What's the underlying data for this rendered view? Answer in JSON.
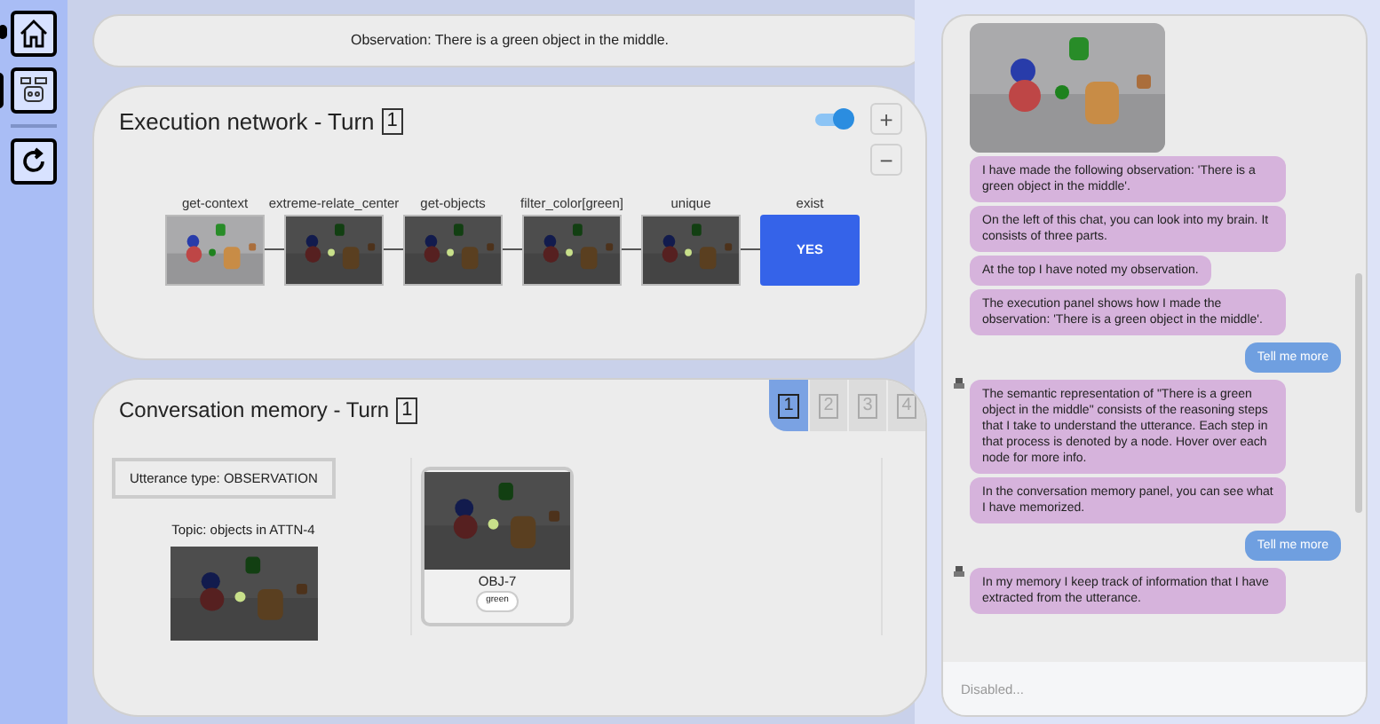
{
  "observation": "Observation: There is a green object in the middle.",
  "execution": {
    "title": "Execution network - Turn",
    "turn": "1",
    "toggle": {
      "on": true
    },
    "zoom_in": "+",
    "zoom_out": "−",
    "nodes": [
      {
        "label": "get-context",
        "kind": "scene"
      },
      {
        "label": "extreme-relate_center",
        "kind": "attention"
      },
      {
        "label": "get-objects",
        "kind": "attention"
      },
      {
        "label": "filter_color[green]",
        "kind": "attention"
      },
      {
        "label": "unique",
        "kind": "attention"
      },
      {
        "label": "exist",
        "kind": "answer",
        "answer": "YES"
      }
    ]
  },
  "memory": {
    "title": "Conversation memory - Turn",
    "turn": "1",
    "tabs": [
      {
        "label": "1",
        "selected": true
      },
      {
        "label": "2",
        "selected": false
      },
      {
        "label": "3",
        "selected": false
      },
      {
        "label": "4",
        "selected": false
      }
    ],
    "utterance_type": "Utterance type: OBSERVATION",
    "topic": "Topic: objects in ATTN-4",
    "objects": [
      {
        "name": "OBJ-7",
        "tags": [
          "green"
        ]
      }
    ]
  },
  "chat": {
    "messages": [
      {
        "kind": "picture"
      },
      {
        "kind": "bot",
        "text": "I have made the following observation: 'There is a green object in the middle'."
      },
      {
        "kind": "bot",
        "text": "On the left of this chat, you can look into my brain. It consists of three parts."
      },
      {
        "kind": "bot",
        "text": "At the top I have noted my observation."
      },
      {
        "kind": "bot",
        "text": "The execution panel shows how I made the observation: 'There is a green object in the middle'."
      },
      {
        "kind": "user",
        "text": "Tell me more"
      },
      {
        "kind": "bot",
        "text": "The semantic representation of \"There is a green object in the middle\" consists of the reasoning steps that I take to understand the utterance. Each step in that process is denoted by a node. Hover over each node for more info."
      },
      {
        "kind": "bot",
        "text": "In the conversation memory panel, you can see what I have memorized."
      },
      {
        "kind": "user",
        "text": "Tell me more"
      },
      {
        "kind": "bot",
        "text": "In my memory I keep track of information that I have extracted from the utterance."
      }
    ],
    "input": {
      "placeholder": "Disabled..."
    }
  }
}
